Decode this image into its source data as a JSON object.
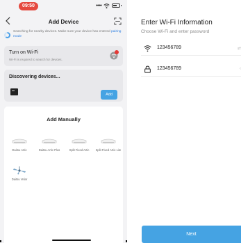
{
  "status_bar": {
    "time": "09:50"
  },
  "add_device": {
    "title": "Add Device",
    "search_text": "Searching for nearby devices. Make sure your device has entered",
    "pairing_link": "pairing mode",
    "wifi_card": {
      "title": "Turn on Wi-Fi",
      "subtitle": "Wi-Fi is required to search for devices."
    },
    "discovering": {
      "title": "Discovering devices...",
      "add_label": "Add"
    },
    "manual": {
      "title": "Add Manually",
      "products": [
        {
          "name": "Daitsu Artic"
        },
        {
          "name": "Daitsu Artic Plus"
        },
        {
          "name": "Split Fixed Artic"
        },
        {
          "name": "Split Fixed Artic Lite"
        },
        {
          "name": "Daitsu Velar"
        }
      ]
    }
  },
  "wifi_info": {
    "title": "Enter Wi-Fi Information",
    "subtitle": "Choose Wi-Fi and enter password",
    "ssid": "123456789",
    "password": "123456789",
    "next_label": "Next"
  },
  "colors": {
    "accent": "#45a3e3",
    "status_pill": "#e5493f",
    "badge": "#e53935"
  },
  "icons": [
    "back-icon",
    "scan-icon",
    "wifi-icon",
    "wifi-off-icon",
    "lock-icon",
    "chevron-right-icon"
  ]
}
